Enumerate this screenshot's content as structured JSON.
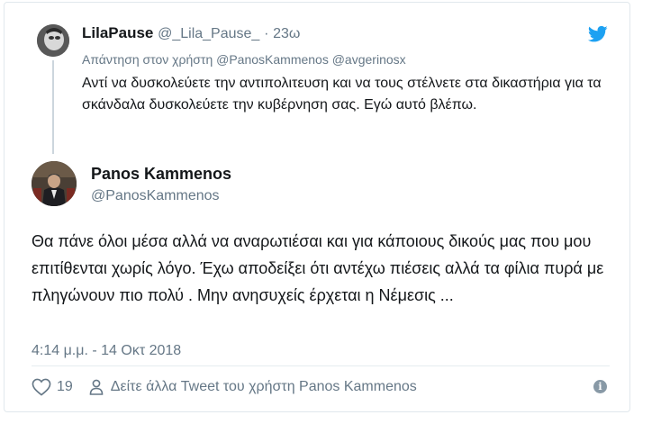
{
  "reply": {
    "name": "LilaPause",
    "handle": "@_Lila_Pause_",
    "separator": "·",
    "time": "23ω",
    "reply_to": "Απάντηση στον χρήστη @PanosKammenos @avgerinosx",
    "text": "Αντί να δυσκολεύετε την αντιπολιτευση και να τους στέλνετε στα δικαστήρια για τα σκάνδαλα δυσκολεύετε την κυβέρνηση σας. Εγώ αυτό βλέπω."
  },
  "tweet": {
    "name": "Panos Kammenos",
    "handle": "@PanosKammenos",
    "text": "Θα πάνε όλοι μέσα αλλά να αναρωτιέσαι και για κάποιους δικούς μας που μου επιτίθενται χωρίς λόγο. Έχω αποδείξει ότι αντέχω πιέσεις αλλά τα φίλια πυρά με πληγώνουν πιο πολύ . Μην ανησυχείς έρχεται η Νέμεσις ...",
    "timestamp": "4:14 μ.μ. - 14 Οκτ 2018"
  },
  "actions": {
    "like_count": "19",
    "more_tweets_label": "Δείτε άλλα Tweet του χρήστη Panos Kammenos"
  },
  "icons": {
    "brand": "twitter-bird-icon",
    "like": "heart-icon",
    "profile": "person-icon",
    "info": "info-icon"
  },
  "colors": {
    "brand": "#1da1f2",
    "secondary_text": "#657786",
    "thread_line": "#ccd6dd"
  }
}
